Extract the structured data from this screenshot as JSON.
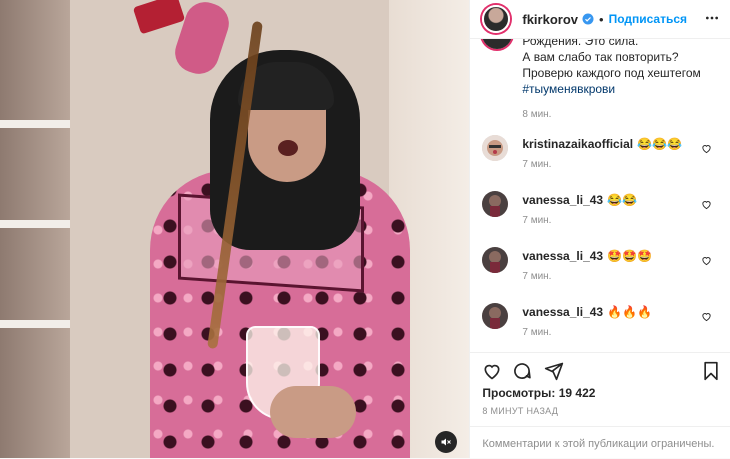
{
  "header": {
    "username": "fkirkorov",
    "separator": "•",
    "follow_label": "Подписаться"
  },
  "caption": {
    "partial_line": "Рождения. Это сила.",
    "line2": "А вам слабо так повторить?",
    "line3": "Проверю каждого под хештегом",
    "hashtag": "#тыуменявкрови",
    "time": "8 мин."
  },
  "comments": [
    {
      "username": "kristinazaikaofficial",
      "text": "😂😂😂",
      "time": "7 мин."
    },
    {
      "username": "vanessa_li_43",
      "text": "😂😂",
      "time": "7 мин."
    },
    {
      "username": "vanessa_li_43",
      "text": "🤩🤩🤩",
      "time": "7 мин."
    },
    {
      "username": "vanessa_li_43",
      "text": "🔥🔥🔥",
      "time": "7 мин."
    }
  ],
  "stats": {
    "views_label": "Просмотры:",
    "views_count": "19 422",
    "posted_ago": "8 МИНУТ НАЗАД"
  },
  "footer": {
    "comments_disabled": "Комментарии к этой публикации ограничены."
  },
  "icons": {
    "verified": "verified-badge-icon",
    "more": "more-horizontal-icon",
    "like": "heart-icon",
    "comment": "comment-bubble-icon",
    "share": "paper-plane-icon",
    "save": "bookmark-icon",
    "mute": "muted-speaker-icon"
  },
  "colors": {
    "accent": "#0095f6",
    "verified": "#3897f0",
    "muted_text": "#8e8e8e",
    "hashtag": "#00376b"
  }
}
